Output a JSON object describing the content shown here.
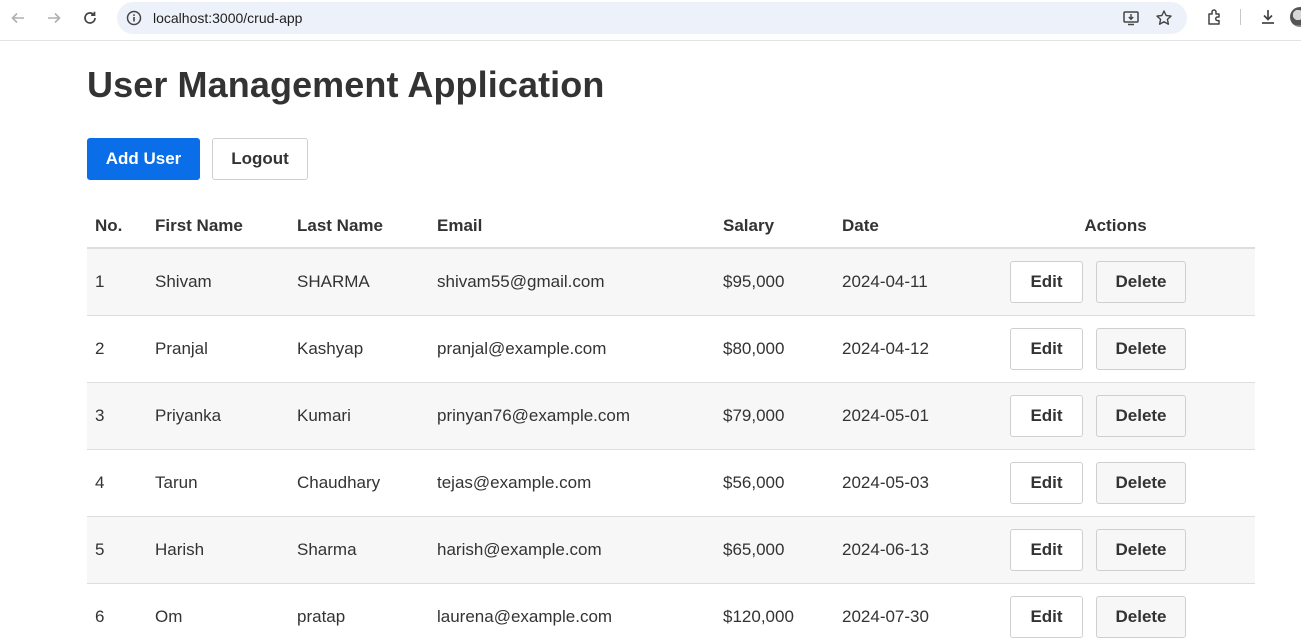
{
  "browser": {
    "url": "localhost:3000/crud-app"
  },
  "page": {
    "title": "User Management Application",
    "add_user_label": "Add User",
    "logout_label": "Logout"
  },
  "table": {
    "headers": [
      "No.",
      "First Name",
      "Last Name",
      "Email",
      "Salary",
      "Date",
      "Actions"
    ],
    "edit_label": "Edit",
    "delete_label": "Delete",
    "rows": [
      {
        "no": "1",
        "first": "Shivam",
        "last": "SHARMA",
        "email": "shivam55@gmail.com",
        "salary": "$95,000",
        "date": "2024-04-11"
      },
      {
        "no": "2",
        "first": "Pranjal",
        "last": "Kashyap",
        "email": "pranjal@example.com",
        "salary": "$80,000",
        "date": "2024-04-12"
      },
      {
        "no": "3",
        "first": "Priyanka",
        "last": "Kumari",
        "email": "prinyan76@example.com",
        "salary": "$79,000",
        "date": "2024-05-01"
      },
      {
        "no": "4",
        "first": "Tarun",
        "last": "Chaudhary",
        "email": "tejas@example.com",
        "salary": "$56,000",
        "date": "2024-05-03"
      },
      {
        "no": "5",
        "first": "Harish",
        "last": "Sharma",
        "email": "harish@example.com",
        "salary": "$65,000",
        "date": "2024-06-13"
      },
      {
        "no": "6",
        "first": "Om",
        "last": "pratap",
        "email": "laurena@example.com",
        "salary": "$120,000",
        "date": "2024-07-30"
      }
    ]
  },
  "colors": {
    "primary": "#0a6ee8",
    "row_stripe": "#f7f7f7",
    "omnibox_bg": "#edf2fa"
  },
  "icons": [
    "back-icon",
    "forward-icon",
    "reload-icon",
    "site-info-icon",
    "install-icon",
    "bookmark-star-icon",
    "extensions-icon",
    "download-icon",
    "profile-avatar"
  ]
}
